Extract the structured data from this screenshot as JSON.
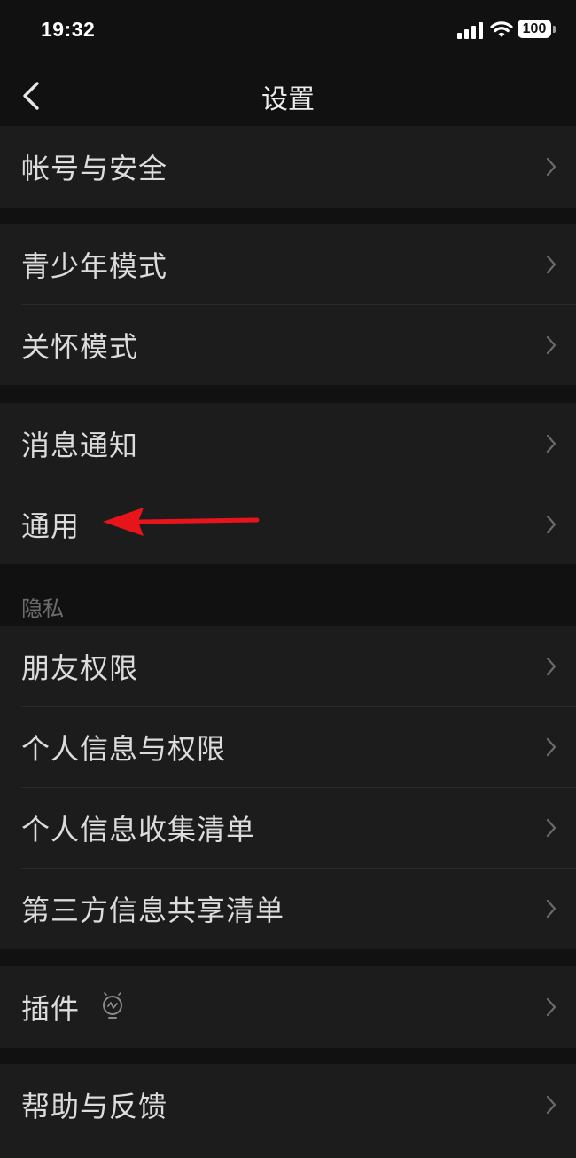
{
  "status_bar": {
    "time": "19:32",
    "battery": "100"
  },
  "nav": {
    "title": "设置"
  },
  "groups": {
    "account": [
      "帐号与安全"
    ],
    "modes": [
      "青少年模式",
      "关怀模式"
    ],
    "general": [
      "消息通知",
      "通用"
    ],
    "privacy_header": "隐私",
    "privacy": [
      "朋友权限",
      "个人信息与权限",
      "个人信息收集清单",
      "第三方信息共享清单"
    ],
    "plugins": [
      "插件"
    ],
    "help": [
      "帮助与反馈"
    ]
  },
  "colors": {
    "background": "#111111",
    "cell": "#1c1c1c",
    "text": "#dcdcdc",
    "annotation_arrow": "#e8141c"
  }
}
